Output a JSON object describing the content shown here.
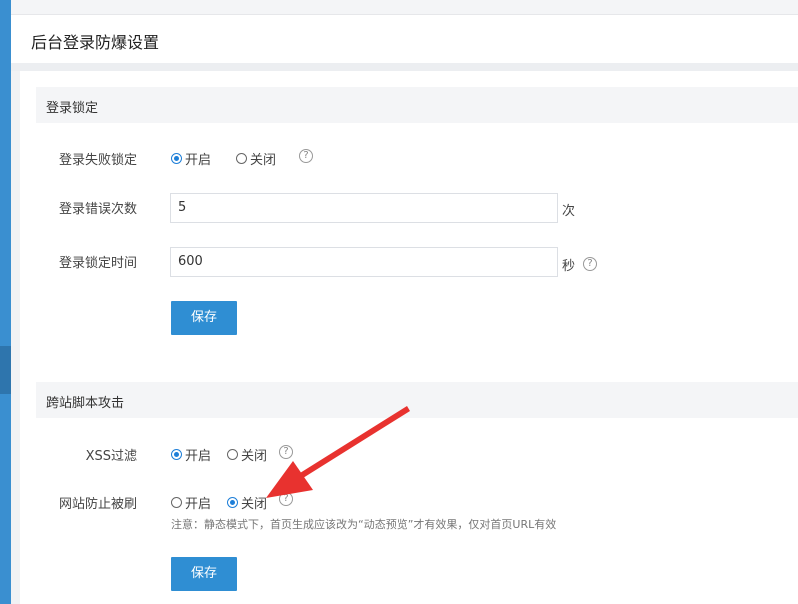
{
  "page": {
    "title": "后台登录防爆设置"
  },
  "sections": {
    "lock": {
      "title": "登录锁定",
      "fail_lock": {
        "label": "登录失败锁定",
        "on": "开启",
        "off": "关闭",
        "selected": "on"
      },
      "attempts": {
        "label": "登录错误次数",
        "value": "5",
        "unit": "次"
      },
      "lock_time": {
        "label": "登录锁定时间",
        "value": "600",
        "unit": "秒"
      },
      "save_label": "保存"
    },
    "xss": {
      "title": "跨站脚本攻击",
      "filter": {
        "label": "XSS过滤",
        "on": "开启",
        "off": "关闭",
        "selected": "on"
      },
      "anti_refresh": {
        "label": "网站防止被刷",
        "on": "开启",
        "off": "关闭",
        "selected": "off"
      },
      "note": "注意：静态模式下，首页生成应该改为“动态预览”才有效果，仅对首页URL有效",
      "save_label": "保存"
    }
  },
  "icons": {
    "help": "help-circle-icon"
  },
  "colors": {
    "accent": "#2f8ed3",
    "radio": "#1e7fd8",
    "arrow": "#e8322f"
  }
}
